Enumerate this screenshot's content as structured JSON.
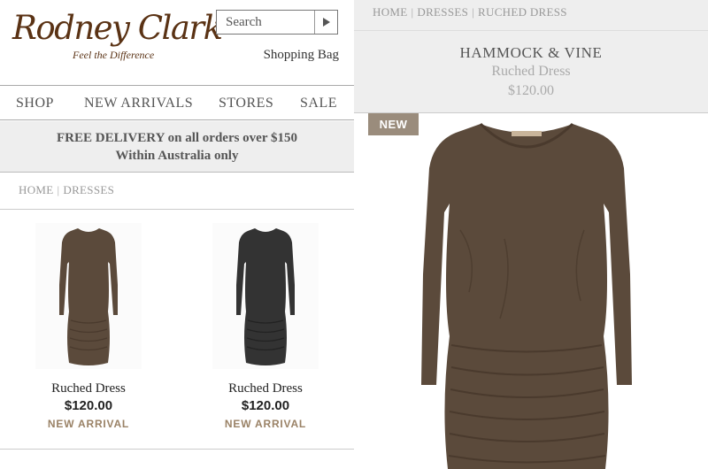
{
  "logo": {
    "wordmark": "Rodney Clark",
    "tagline": "Feel the Difference"
  },
  "search": {
    "placeholder": "Search"
  },
  "header": {
    "shopping_bag": "Shopping Bag"
  },
  "nav": {
    "items": [
      "SHOP",
      "NEW ARRIVALS",
      "STORES",
      "SALE"
    ]
  },
  "delivery": {
    "line1": "FREE DELIVERY on all orders over $150",
    "line2": "Within Australia only"
  },
  "left_breadcrumb": [
    "HOME",
    "DRESSES"
  ],
  "products": [
    {
      "name": "Ruched Dress",
      "price": "$120.00",
      "badge": "NEW ARRIVAL",
      "color": "#5b4a3b"
    },
    {
      "name": "Ruched Dress",
      "price": "$120.00",
      "badge": "NEW ARRIVAL",
      "color": "#333333"
    }
  ],
  "detail": {
    "breadcrumb": [
      "HOME",
      "DRESSES",
      "RUCHED DRESS"
    ],
    "brand": "HAMMOCK & VINE",
    "name": "Ruched Dress",
    "price": "$120.00",
    "badge": "NEW",
    "dress_color": "#5b4a3b"
  },
  "colors": {
    "brand_brown": "#5a3214",
    "accent_taupe": "#9a8266",
    "badge_bg": "#9a8c7c",
    "band_grey": "#eeeeee"
  }
}
